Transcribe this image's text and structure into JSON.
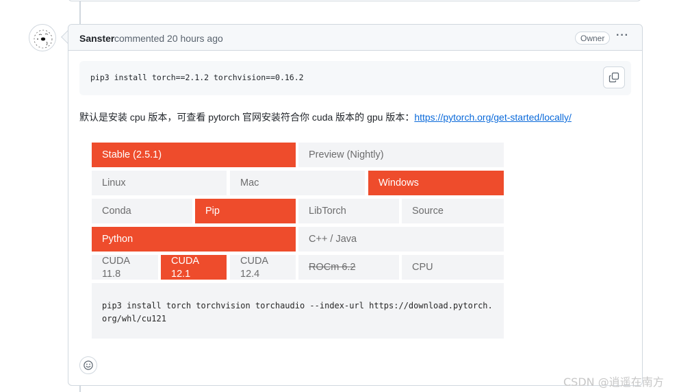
{
  "comment": {
    "author": "Sanster",
    "action": "commented 20 hours ago",
    "badge": "Owner",
    "menu_icon": "kebab-horizontal-icon"
  },
  "code_block": {
    "text": "pip3 install torch==2.1.2 torchvision==0.16.2",
    "copy_icon": "copy-icon"
  },
  "paragraph": {
    "text": "默认是安装 cpu 版本，可查看 pytorch 官网安装符合你 cuda 版本的 gpu 版本：",
    "link": "https://pytorch.org/get-started/locally/"
  },
  "selector": {
    "build": [
      "Stable (2.5.1)",
      "Preview (Nightly)"
    ],
    "os": [
      "Linux",
      "Mac",
      "Windows"
    ],
    "package": [
      "Conda",
      "Pip",
      "LibTorch",
      "Source"
    ],
    "language": [
      "Python",
      "C++ / Java"
    ],
    "compute": [
      {
        "line1": "CUDA",
        "line2": "11.8"
      },
      {
        "line1": "CUDA",
        "line2": "12.1"
      },
      {
        "line1": "CUDA",
        "line2": "12.4"
      },
      {
        "label": "ROCm 6.2"
      },
      {
        "label": "CPU"
      }
    ],
    "command_line1": "pip3 install torch torchvision torchaudio --index-url https://download.pytorch.",
    "command_line2": "org/whl/cu121",
    "accent_color": "#ee4c2c"
  },
  "reaction_icon": "smiley-icon",
  "watermark": "CSDN @逍遥在南方"
}
